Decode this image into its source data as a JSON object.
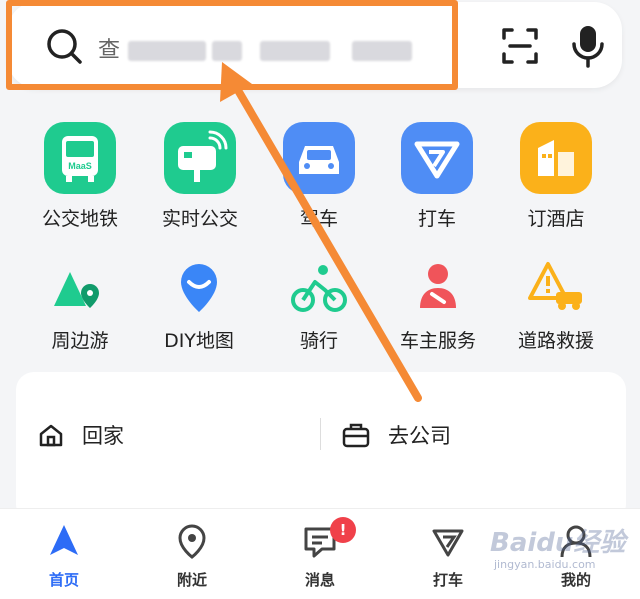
{
  "search": {
    "placeholder_start": "查",
    "scan_label": "",
    "mic_label": ""
  },
  "services_row1": [
    {
      "name": "公交地铁",
      "tile_text": "MaaS",
      "color": "#1fcb8f"
    },
    {
      "name": "实时公交",
      "color": "#1fcb8f"
    },
    {
      "name": "驾车",
      "color": "#4f8df5"
    },
    {
      "name": "打车",
      "color": "#4f8df5"
    },
    {
      "name": "订酒店",
      "color": "#fbb11a"
    }
  ],
  "services_row2": [
    {
      "name": "周边游",
      "color": "#1fcb8f"
    },
    {
      "name": "DIY地图",
      "color": "#3a86f7"
    },
    {
      "name": "骑行",
      "color": "#1fcb8f"
    },
    {
      "name": "车主服务",
      "color": "#f0545a"
    },
    {
      "name": "道路救援",
      "color": "#fbb11a"
    }
  ],
  "shortcuts": {
    "home": "回家",
    "work": "去公司"
  },
  "tabs": [
    {
      "label": "首页",
      "active": true
    },
    {
      "label": "附近",
      "active": false
    },
    {
      "label": "消息",
      "active": false,
      "badge": "!"
    },
    {
      "label": "打车",
      "active": false
    },
    {
      "label": "我的",
      "active": false
    }
  ],
  "annotation": {
    "highlight_color": "#f58a35"
  },
  "watermark": {
    "text": "Baidu经验",
    "sub": "jingyan.baidu.com"
  }
}
